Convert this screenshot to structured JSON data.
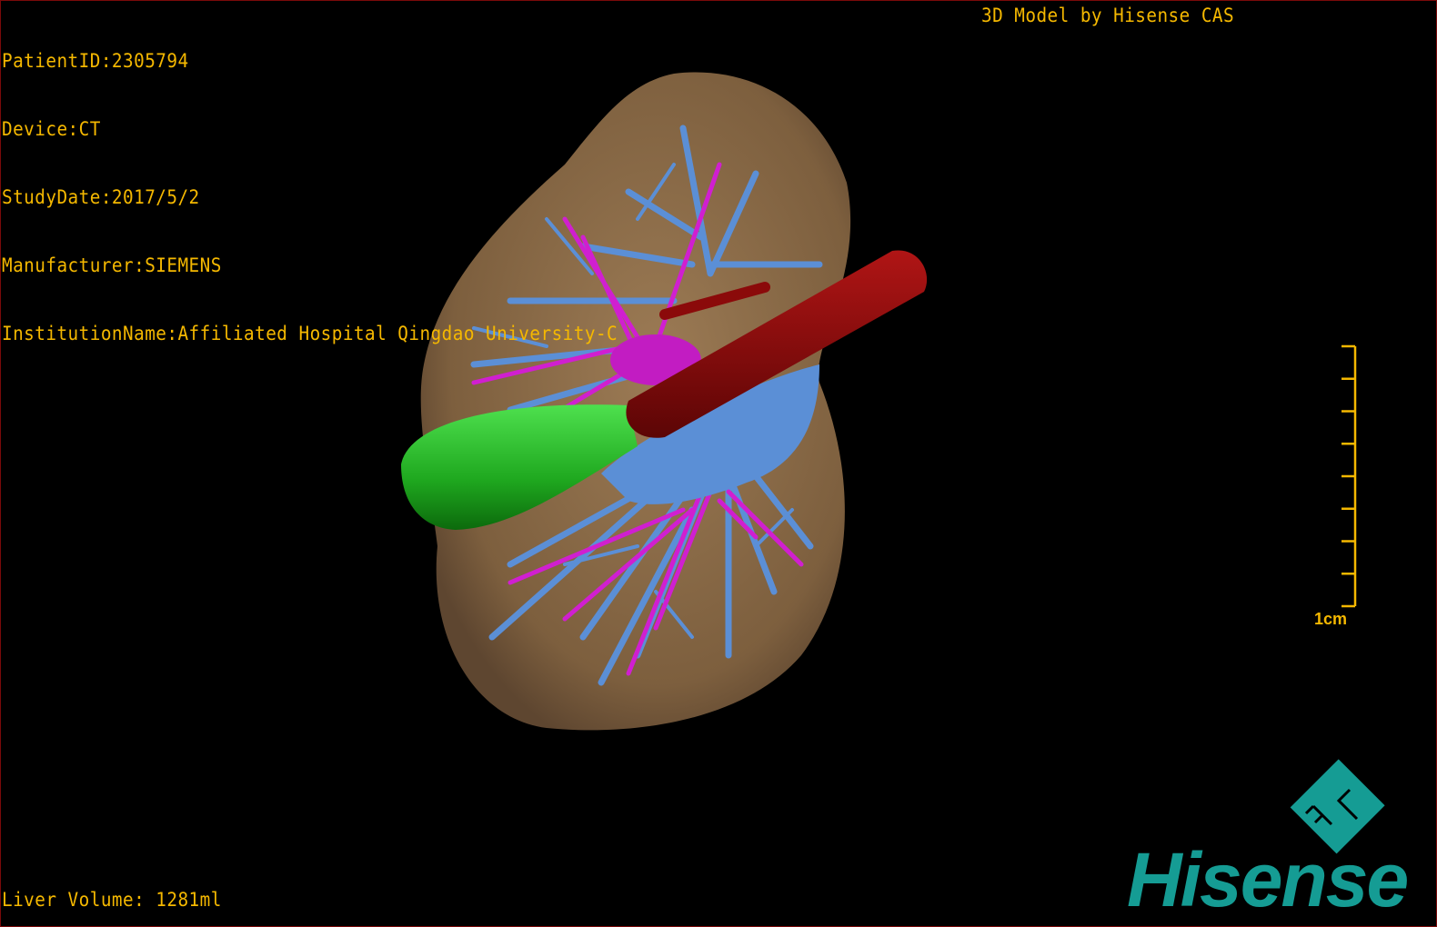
{
  "overlay": {
    "patient_id": "PatientID:2305794",
    "device": "Device:CT",
    "study_date": "StudyDate:2017/5/2",
    "manufacturer": "Manufacturer:SIEMENS",
    "institution": "InstitutionName:Affiliated Hospital Qingdao University-C",
    "brand_caption": "3D Model by Hisense CAS",
    "liver_volume": "Liver Volume: 1281ml"
  },
  "scale_bar": {
    "label": "1cm",
    "ticks": 9
  },
  "logo": {
    "text": "Hisense",
    "badge": "FL",
    "color": "#159c94"
  },
  "colors": {
    "text": "#f5b800",
    "liver": "#8a6a45",
    "portal_vein": "#5b8fd6",
    "hepatic_artery": "#d01fd0",
    "ivc": "#8b0a0a",
    "gallbladder": "#22b322"
  }
}
